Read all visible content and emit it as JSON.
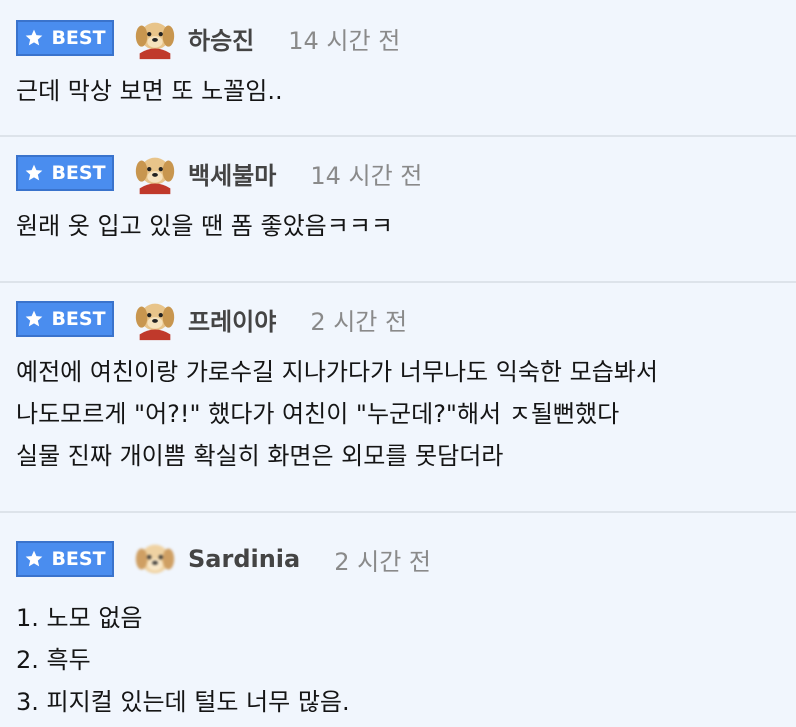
{
  "badge_label": "BEST",
  "colors": {
    "badge_bg": "#4a8def",
    "background": "#f1f6fd",
    "divider": "#dde3ea"
  },
  "comments": [
    {
      "nickname": "하승진",
      "time": "14 시간 전",
      "lines": [
        "근데 막상 보면 또 노꼴임.."
      ]
    },
    {
      "nickname": "백세불마",
      "time": "14 시간 전",
      "lines": [
        "원래 옷 입고 있을 땐 폼 좋았음ㅋㅋㅋ"
      ]
    },
    {
      "nickname": "프레이야",
      "time": "2 시간 전",
      "lines": [
        "예전에 여친이랑 가로수길 지나가다가 너무나도 익숙한 모습봐서",
        "나도모르게 \"어?!\" 했다가 여친이 \"누군데?\"해서 ㅈ될뻔했다",
        "실물 진짜 개이쁨 확실히 화면은 외모를 못담더라"
      ]
    },
    {
      "nickname": "Sardinia",
      "time": "2 시간 전",
      "lines": [
        "1. 노모 없음",
        "2. 흑두",
        "3. 피지컬 있는데 털도 너무 많음."
      ]
    }
  ]
}
